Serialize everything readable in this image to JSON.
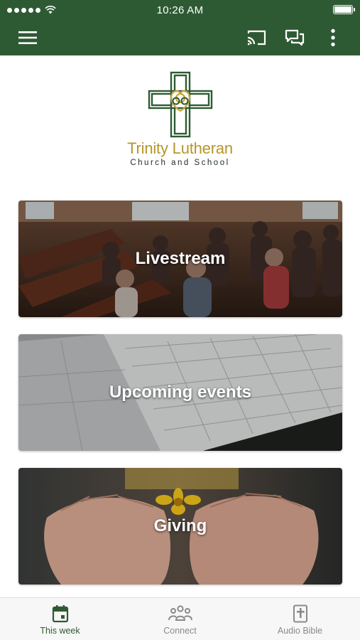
{
  "status_bar": {
    "time": "10:26 AM"
  },
  "colors": {
    "brand": "#2e5a33",
    "logo_gold": "#b7962a",
    "inactive": "#8a8a8a"
  },
  "app_bar": {
    "icons": [
      "menu-icon",
      "cast-icon",
      "chat-icon",
      "more-vertical-icon"
    ]
  },
  "logo": {
    "title": "Trinity Lutheran",
    "subtitle": "Church and School"
  },
  "cards": [
    {
      "label": "Livestream"
    },
    {
      "label": "Upcoming events"
    },
    {
      "label": "Giving"
    }
  ],
  "bottom_nav": {
    "items": [
      {
        "label": "This week",
        "icon": "calendar-icon",
        "active": true
      },
      {
        "label": "Connect",
        "icon": "people-icon",
        "active": false
      },
      {
        "label": "Audio Bible",
        "icon": "bible-icon",
        "active": false
      }
    ]
  }
}
